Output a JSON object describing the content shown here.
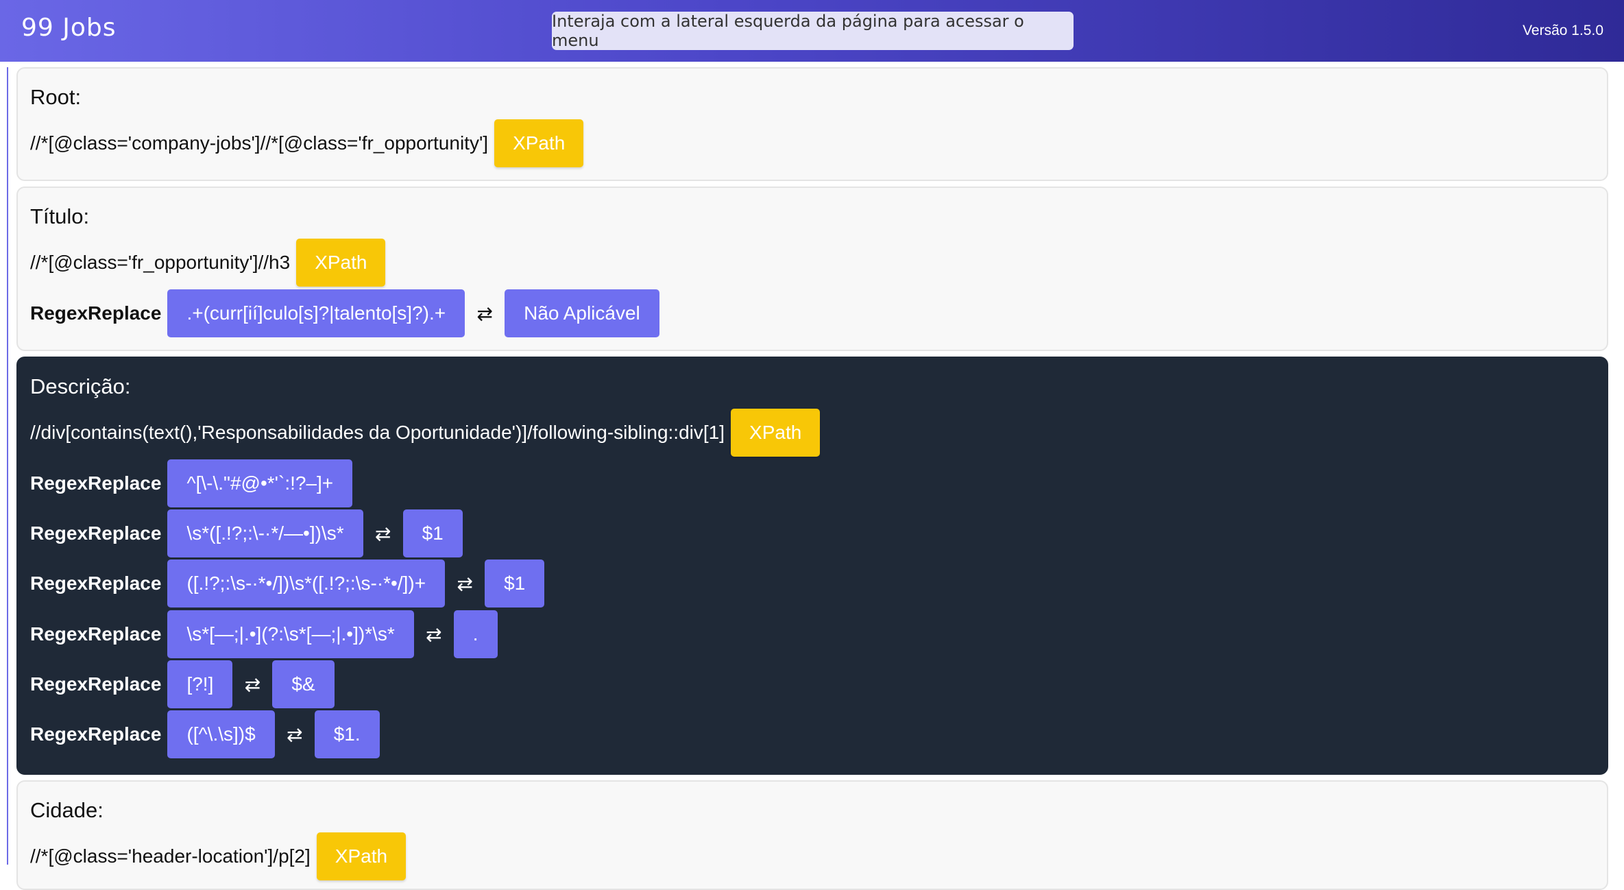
{
  "header": {
    "title": "99 Jobs",
    "hint": "Interaja com a lateral esquerda da página para acessar o menu",
    "version": "Versão 1.5.0"
  },
  "colors": {
    "accent": "#6f6ff0",
    "xpath_button": "#f8c707",
    "dark_card": "#1f2937"
  },
  "swap_icon": "⇄",
  "sections": {
    "root": {
      "title": "Root:",
      "xpath": "//*[@class='company-jobs']//*[@class='fr_opportunity']",
      "xpath_button": "XPath"
    },
    "titulo": {
      "title": "Título:",
      "xpath": "//*[@class='fr_opportunity']//h3",
      "xpath_button": "XPath",
      "regex": [
        {
          "label": "RegexReplace",
          "pattern": ".+(curr[ií]culo[s]?|talento[s]?).+",
          "replacement": "Não Aplicável"
        }
      ]
    },
    "descricao": {
      "title": "Descrição:",
      "xpath": "//div[contains(text(),'Responsabilidades da Oportunidade')]/following-sibling::div[1]",
      "xpath_button": "XPath",
      "regex": [
        {
          "label": "RegexReplace",
          "pattern": "^[\\-\\.\"#@•*'`:!?–]+"
        },
        {
          "label": "RegexReplace",
          "pattern": "\\s*([.!?;:\\-·*/—•])\\s*",
          "replacement": "$1"
        },
        {
          "label": "RegexReplace",
          "pattern": "([.!?;:\\s-·*•/])\\s*([.!?;:\\s-·*•/])+",
          "replacement": "$1"
        },
        {
          "label": "RegexReplace",
          "pattern": "\\s*[—;|.•](?:\\s*[—;|.•])*\\s*",
          "replacement": "."
        },
        {
          "label": "RegexReplace",
          "pattern": "[?!]",
          "replacement": "$&"
        },
        {
          "label": "RegexReplace",
          "pattern": "([^\\.\\s])$",
          "replacement": "$1."
        }
      ]
    },
    "cidade": {
      "title": "Cidade:",
      "xpath": "//*[@class='header-location']/p[2]",
      "xpath_button": "XPath"
    }
  }
}
